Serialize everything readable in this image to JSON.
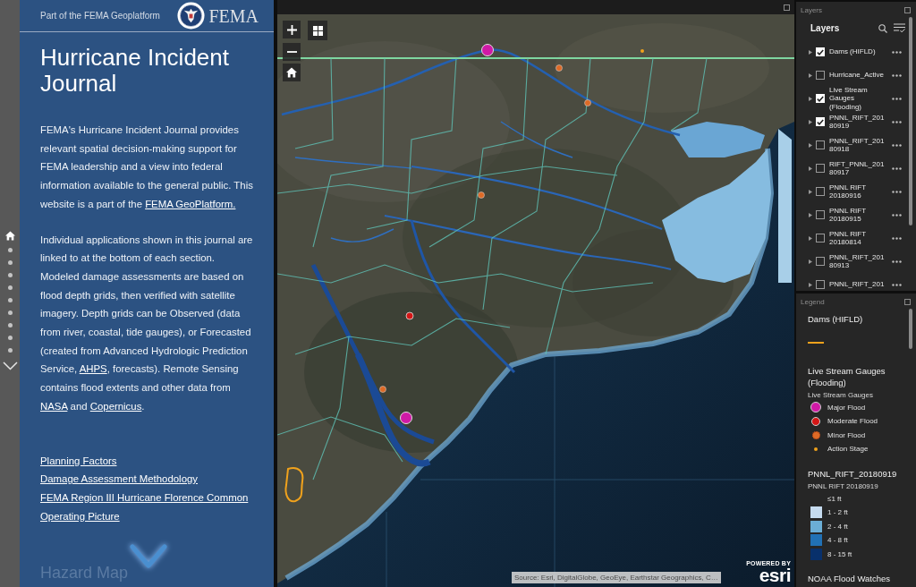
{
  "nav": {
    "items": [
      {
        "kind": "home",
        "selected": true
      },
      {
        "kind": "dot",
        "selected": false
      },
      {
        "kind": "dot",
        "selected": false
      },
      {
        "kind": "dot",
        "selected": false
      },
      {
        "kind": "dot",
        "selected": false
      },
      {
        "kind": "dot",
        "selected": false
      },
      {
        "kind": "dot",
        "selected": false
      },
      {
        "kind": "dot",
        "selected": false
      },
      {
        "kind": "dot",
        "selected": false
      },
      {
        "kind": "dot",
        "selected": false
      }
    ]
  },
  "header": {
    "tagline": "Part of the FEMA Geoplatform",
    "logo_text": "FEMA"
  },
  "journal": {
    "title": "Hurricane Incident Journal",
    "paragraphs": [
      [
        {
          "kind": "text",
          "text": "FEMA's Hurricane Incident Journal provides relevant spatial decision-making support for FEMA leadership and a view into federal information available to the general public. This website is a part of the "
        },
        {
          "kind": "link",
          "text": "FEMA GeoPlatform."
        }
      ],
      [
        {
          "kind": "text",
          "text": "Individual applications shown in this journal are linked to at the bottom of each section. Modeled damage assessments are based on flood depth grids, then verified with satellite imagery. Depth grids can be Observed (data from river, coastal, tide gauges), or Forecasted (created from Advanced Hydrologic Prediction Service, "
        },
        {
          "kind": "link",
          "text": "AHPS"
        },
        {
          "kind": "text",
          "text": ", forecasts). Remote Sensing contains flood extents and other data from "
        },
        {
          "kind": "link",
          "text": "NASA"
        },
        {
          "kind": "text",
          "text": " and "
        },
        {
          "kind": "link",
          "text": "Copernicus"
        },
        {
          "kind": "text",
          "text": "."
        }
      ]
    ],
    "links": [
      "Planning Factors",
      "Damage Assessment Methodology",
      "FEMA Region III Hurricane Florence Common Operating Picture"
    ],
    "next_section": "Hazard Map"
  },
  "map": {
    "attribution": "Source: Esri, DigitalGlobe, GeoEye, Earthstar Geographics, C…",
    "logo": {
      "caption": "POWERED BY",
      "wordmark": "esri"
    }
  },
  "layers": {
    "panel_title": "Layers",
    "heading": "Layers",
    "items": [
      {
        "label": "Dams (HIFLD)",
        "checked": true
      },
      {
        "label": "Hurricane_Active",
        "checked": false
      },
      {
        "label": "Live Stream Gauges (Flooding)",
        "checked": true
      },
      {
        "label": "PNNL_RIFT_20180919",
        "checked": true
      },
      {
        "label": "PNNL_RIFT_20180918",
        "checked": false
      },
      {
        "label": "RIFT_PNNL_20180917",
        "checked": false
      },
      {
        "label": "PNNL RIFT 20180916",
        "checked": false
      },
      {
        "label": "PNNL RIFT 20180915",
        "checked": false
      },
      {
        "label": "PNNL RIFT 20180814",
        "checked": false
      },
      {
        "label": "PNNL_RIFT_20180913",
        "checked": false
      },
      {
        "label": "PNNL_RIFT_201",
        "checked": false
      }
    ]
  },
  "legend": {
    "panel_title": "Legend",
    "sections": [
      {
        "title": "Dams (HIFLD)",
        "items": [
          {
            "kind": "line",
            "color": "#f0a21c"
          }
        ]
      },
      {
        "title": "Live Stream Gauges (Flooding)",
        "subtitle": "Live Stream Gauges",
        "items": [
          {
            "kind": "large",
            "label": "Major Flood",
            "color": "#d01aa6"
          },
          {
            "kind": "medium",
            "label": "Moderate Flood",
            "color": "#d41616"
          },
          {
            "kind": "hatched",
            "label": "Minor Flood",
            "color": "#de6a26"
          },
          {
            "kind": "dot",
            "label": "Action Stage",
            "color": "#f0a21c"
          }
        ]
      },
      {
        "title": "PNNL_RIFT_20180919",
        "subtitle": "PNNL RIFT 20180919",
        "items": [
          {
            "kind": "blank",
            "label": "≤1 ft"
          },
          {
            "kind": "swatch",
            "label": "1 - 2 ft",
            "color": "#c6dbef"
          },
          {
            "kind": "swatch",
            "label": "2 - 4 ft",
            "color": "#6baed6"
          },
          {
            "kind": "swatch",
            "label": "4 - 8 ft",
            "color": "#2171b5"
          },
          {
            "kind": "swatch",
            "label": "8 - 15 ft",
            "color": "#08306b"
          }
        ]
      },
      {
        "title": "NOAA Flood Watches"
      }
    ]
  }
}
